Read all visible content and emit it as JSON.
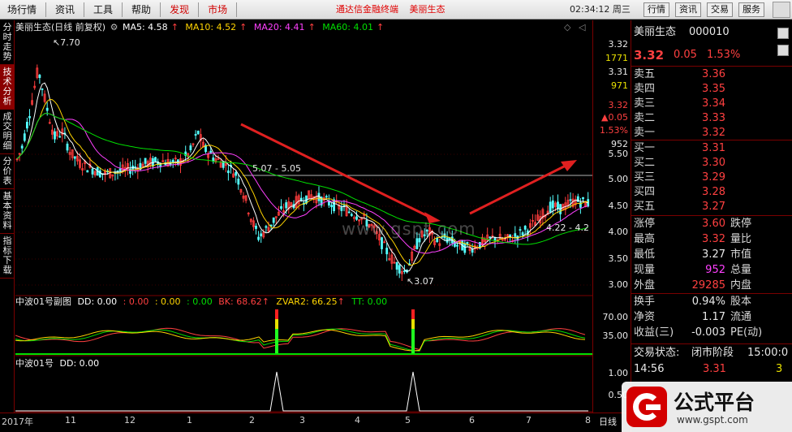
{
  "menu": {
    "items": [
      "场行情",
      "资讯",
      "工具",
      "帮助"
    ],
    "active_items": [
      "发现",
      "市场"
    ],
    "promo": [
      "通达信金融终端",
      "美丽生态"
    ],
    "clock": "02:34:12 周三",
    "right_buttons": [
      "行情",
      "资讯",
      "交易",
      "服务"
    ]
  },
  "left_tabs": [
    "分时走势",
    "技术分析",
    "成交明细",
    "分价表",
    "基本资料",
    "指标下载"
  ],
  "main_panel": {
    "title": "美丽生态(日线 前复权)",
    "ma": [
      {
        "label": "MA5: 4.58",
        "color": "#ffffff"
      },
      {
        "label": "MA10: 4.52",
        "color": "#ffd400"
      },
      {
        "label": "MA20: 4.41",
        "color": "#ff40ff"
      },
      {
        "label": "MA60: 4.01",
        "color": "#00e000"
      }
    ],
    "annotations": {
      "high": "7.70",
      "range_left": "5.07 - 5.05",
      "low": "3.07",
      "range_right": "4.22 - 4.2"
    },
    "price_axis": [
      "5.50",
      "5.00",
      "4.50",
      "4.00",
      "3.50",
      "3.00"
    ],
    "top_axis": [
      "3.32",
      "1771",
      "3.31",
      "971",
      "3.32",
      "▲0.05",
      "1.53%",
      "952"
    ]
  },
  "sub_panel_1": {
    "title": "中波01号副图",
    "fields": [
      {
        "label": "DD: 0.00",
        "color": "#ffffff"
      },
      {
        "label": ": 0.00",
        "color": "#ff4040"
      },
      {
        "label": ": 0.00",
        "color": "#ffd400"
      },
      {
        "label": ": 0.00",
        "color": "#00e000"
      },
      {
        "label": "BK: 68.62",
        "color": "#ff4040"
      },
      {
        "label": "ZVAR2: 66.25",
        "color": "#ffd400"
      },
      {
        "label": "TT: 0.00",
        "color": "#00e000"
      }
    ],
    "axis": [
      "70.00",
      "35.00"
    ]
  },
  "sub_panel_2": {
    "title": "中波01号",
    "fields": [
      {
        "label": "DD: 0.00",
        "color": "#ffffff"
      }
    ],
    "axis": [
      "1.00",
      "0.50"
    ]
  },
  "timeline": {
    "labels": [
      "2017年",
      "11",
      "12",
      "1",
      "2",
      "3",
      "4",
      "5",
      "6",
      "7",
      "8"
    ],
    "period": "日线"
  },
  "watermark": "www.gspt.com",
  "quote": {
    "name": "美丽生态",
    "code": "000010",
    "price": "3.32",
    "change": "0.05",
    "change_pct": "1.53%",
    "asks": [
      {
        "label": "卖五",
        "price": "3.36"
      },
      {
        "label": "卖四",
        "price": "3.35"
      },
      {
        "label": "卖三",
        "price": "3.34"
      },
      {
        "label": "卖二",
        "price": "3.33"
      },
      {
        "label": "卖一",
        "price": "3.32"
      }
    ],
    "bids": [
      {
        "label": "买一",
        "price": "3.31"
      },
      {
        "label": "买二",
        "price": "3.30"
      },
      {
        "label": "买三",
        "price": "3.29"
      },
      {
        "label": "买四",
        "price": "3.28"
      },
      {
        "label": "买五",
        "price": "3.27"
      }
    ],
    "stats": [
      {
        "label": "涨停",
        "value": "3.60",
        "label2": "跌停",
        "color": "#ff4040"
      },
      {
        "label": "最高",
        "value": "3.32",
        "label2": "量比",
        "color": "#ff4040"
      },
      {
        "label": "最低",
        "value": "3.27",
        "label2": "市值",
        "color": "#e8e8e8"
      },
      {
        "label": "现量",
        "value": "952",
        "label2": "总量",
        "color": "#ff40ff"
      },
      {
        "label": "外盘",
        "value": "29285",
        "label2": "内盘",
        "color": "#ff4040"
      }
    ],
    "stats2": [
      {
        "label": "换手",
        "value": "0.94%",
        "label2": "股本"
      },
      {
        "label": "净资",
        "value": "1.17",
        "label2": "流通"
      },
      {
        "label": "收益(三)",
        "value": "-0.003",
        "label2": "PE(动)"
      }
    ],
    "trade_status_label": "交易状态:",
    "trade_status": "闭市阶段",
    "trade_time": "15:00:0",
    "ticks": [
      {
        "time": "14:56",
        "price": "3.31",
        "vol": "3"
      }
    ]
  },
  "logo": {
    "title": "公式平台",
    "url": "www.gspt.com"
  }
}
